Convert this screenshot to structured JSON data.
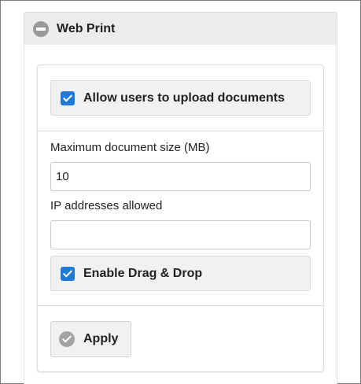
{
  "section": {
    "title": "Web Print",
    "icon": "minus-circle-icon"
  },
  "upload": {
    "label": "Allow users to upload documents",
    "checked": true
  },
  "max_size": {
    "label": "Maximum document size (MB)",
    "value": "10"
  },
  "ip": {
    "label": "IP addresses allowed",
    "value": ""
  },
  "drag_drop": {
    "label": "Enable Drag & Drop",
    "checked": true
  },
  "apply": {
    "label": "Apply",
    "icon": "check-circle-icon"
  },
  "colors": {
    "accent": "#1f7ad8",
    "header_bg": "#ececec",
    "button_bg": "#f1f1f1"
  }
}
